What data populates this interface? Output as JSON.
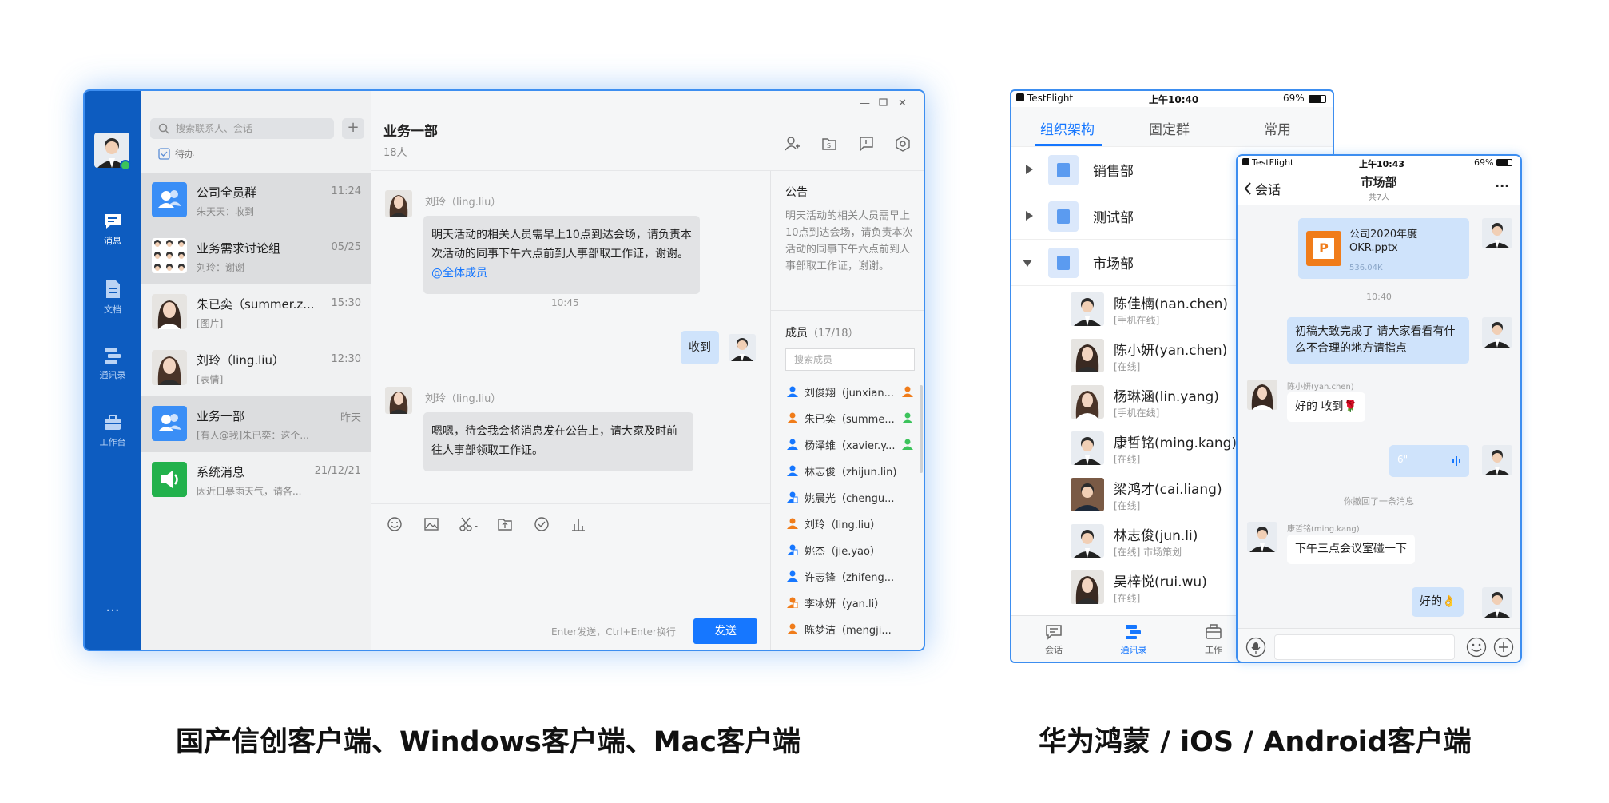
{
  "desktop": {
    "search_placeholder": "搜索联系人、会话",
    "plus": "+",
    "todo": "待办",
    "rail": [
      {
        "label": "消息",
        "icon": "message-icon"
      },
      {
        "label": "文档",
        "icon": "document-icon"
      },
      {
        "label": "通讯录",
        "icon": "contacts-icon"
      },
      {
        "label": "工作台",
        "icon": "briefcase-icon"
      }
    ],
    "rail_more": "···",
    "conversations": [
      {
        "name": "公司全员群",
        "time": "11:24",
        "preview": "朱天天：收到"
      },
      {
        "name": "业务需求讨论组",
        "time": "05/25",
        "preview": "刘玲：谢谢"
      },
      {
        "name": "朱已奕（summer.z...",
        "time": "15:30",
        "preview": "[图片]"
      },
      {
        "name": "刘玲（ling.liu）",
        "time": "12:30",
        "preview": "[表情]"
      },
      {
        "name": "业务一部",
        "time": "昨天",
        "preview": "[有人@我]朱已奕：这个..."
      },
      {
        "name": "系统消息",
        "time": "21/12/21",
        "preview": "因近日暴雨天气，请各..."
      }
    ],
    "chat": {
      "title": "业务一部",
      "member_count": "18人",
      "messages": [
        {
          "sender": "刘玲（ling.liu）",
          "text": "明天活动的相关人员需早上10点到达会场，请负责本次活动的同事下午六点前到人事部取工作证，谢谢。",
          "mention": "@全体成员"
        },
        {
          "time": "10:45"
        },
        {
          "self_text": "收到"
        },
        {
          "sender": "刘玲（ling.liu）",
          "text": "嗯嗯，待会我会将消息发在公告上，请大家及时前往人事部领取工作证。"
        }
      ],
      "input_hint": "Enter发送，Ctrl+Enter换行",
      "send_button": "发送"
    },
    "announcement": {
      "title": "公告",
      "text": "明天活动的相关人员需早上10点到达会场，请负责本次活动的同事下午六点前到人事部取工作证，谢谢。"
    },
    "members": {
      "title": "成员",
      "count": "（17/18）",
      "search_placeholder": "搜索成员",
      "list": [
        "刘俊翔（junxian...",
        "朱已奕（summe...",
        "杨泽维（xavier.y...",
        "林志俊（zhijun.lin)",
        "姚晨光（chengu...",
        "刘玲（ling.liu）",
        "姚杰（jie.yao）",
        "许志锋（zhifeng...",
        "李冰妍（yan.li）",
        "陈梦洁（mengji..."
      ]
    }
  },
  "mobile_contacts": {
    "status_left": "TestFlight",
    "status_time": "上午10:40",
    "status_battery": "69%",
    "tabs": [
      "组织架构",
      "固定群",
      "常用"
    ],
    "departments": [
      "销售部",
      "测试部",
      "市场部"
    ],
    "people": [
      {
        "name": "陈佳楠(nan.chen)",
        "status": "[手机在线]"
      },
      {
        "name": "陈小妍(yan.chen)",
        "status": "[在线]"
      },
      {
        "name": "杨琳涵(lin.yang)",
        "status": "[手机在线]"
      },
      {
        "name": "康哲铭(ming.kang)",
        "status": "[在线]"
      },
      {
        "name": "梁鸿才(cai.liang)",
        "status": "[在线]"
      },
      {
        "name": "林志俊(jun.li)",
        "status": "[在线] 市场策划"
      },
      {
        "name": "吴梓悦(rui.wu)",
        "status": "[在线]"
      }
    ],
    "bottom_tabs": [
      "会话",
      "通讯录",
      "工作"
    ]
  },
  "mobile_chat": {
    "status_left": "TestFlight",
    "status_time": "上午10:43",
    "status_battery": "69%",
    "back_label": "会话",
    "title": "市场部",
    "subtitle": "共7人",
    "more": "···",
    "file_name": "公司2020年度OKR.pptx",
    "file_size": "536.04K",
    "time": "10:40",
    "msg1": "初稿大致完成了 请大家看看有什么不合理的地方请指点",
    "sender2": "陈小妍(yan.chen)",
    "msg2": "好的 收到🌹",
    "voice": "6\"",
    "recalled": "你撤回了一条消息",
    "sender3": "康哲铭(ming.kang)",
    "msg3": "下午三点会议室碰一下",
    "msg4": "好的👌"
  },
  "captions": {
    "left": "国产信创客户端、Windows客户端、Mac客户端",
    "right": "华为鸿蒙 / iOS / Android客户端"
  },
  "colors": {
    "accent": "#1677ff",
    "rail": "#0d5cc0",
    "window_border": "#3d8ef0",
    "self_bubble": "#cfe3fb"
  }
}
